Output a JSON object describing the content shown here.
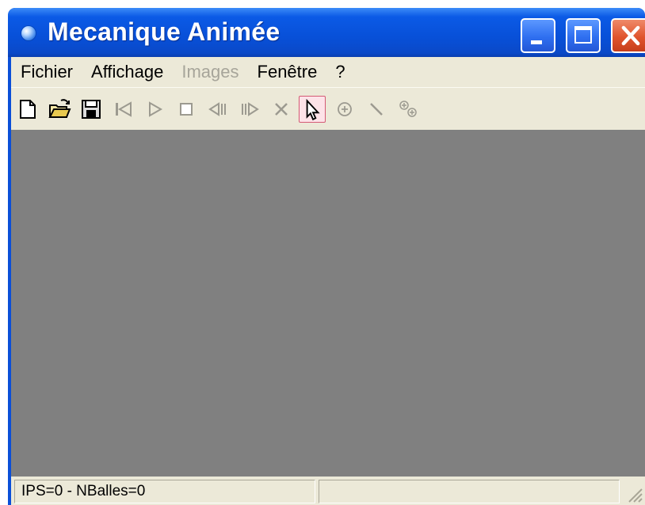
{
  "window": {
    "title": "Mecanique Animée",
    "controls": [
      "minimize",
      "maximize",
      "close"
    ]
  },
  "menu": {
    "items": [
      {
        "label": "Fichier",
        "enabled": true
      },
      {
        "label": "Affichage",
        "enabled": true
      },
      {
        "label": "Images",
        "enabled": false
      },
      {
        "label": "Fenêtre",
        "enabled": true
      },
      {
        "label": "?",
        "enabled": true
      }
    ]
  },
  "toolbar": {
    "buttons": [
      {
        "icon": "new-document-icon"
      },
      {
        "icon": "open-folder-icon"
      },
      {
        "icon": "save-disk-icon"
      },
      {
        "icon": "skip-to-start-icon"
      },
      {
        "icon": "play-icon"
      },
      {
        "icon": "stop-icon"
      },
      {
        "icon": "step-back-icon"
      },
      {
        "icon": "step-forward-icon"
      },
      {
        "icon": "delete-icon"
      },
      {
        "icon": "select-pointer-icon",
        "active": true
      },
      {
        "icon": "add-ball-icon"
      },
      {
        "icon": "draw-line-icon"
      },
      {
        "icon": "add-linked-balls-icon"
      }
    ]
  },
  "status": {
    "pane1": "IPS=0 - NBalles=0",
    "pane2": ""
  },
  "colors": {
    "titlebar": "#0a54e3",
    "canvas": "#808080",
    "face": "#ece9d8",
    "active_tool_border": "#d45a75"
  }
}
